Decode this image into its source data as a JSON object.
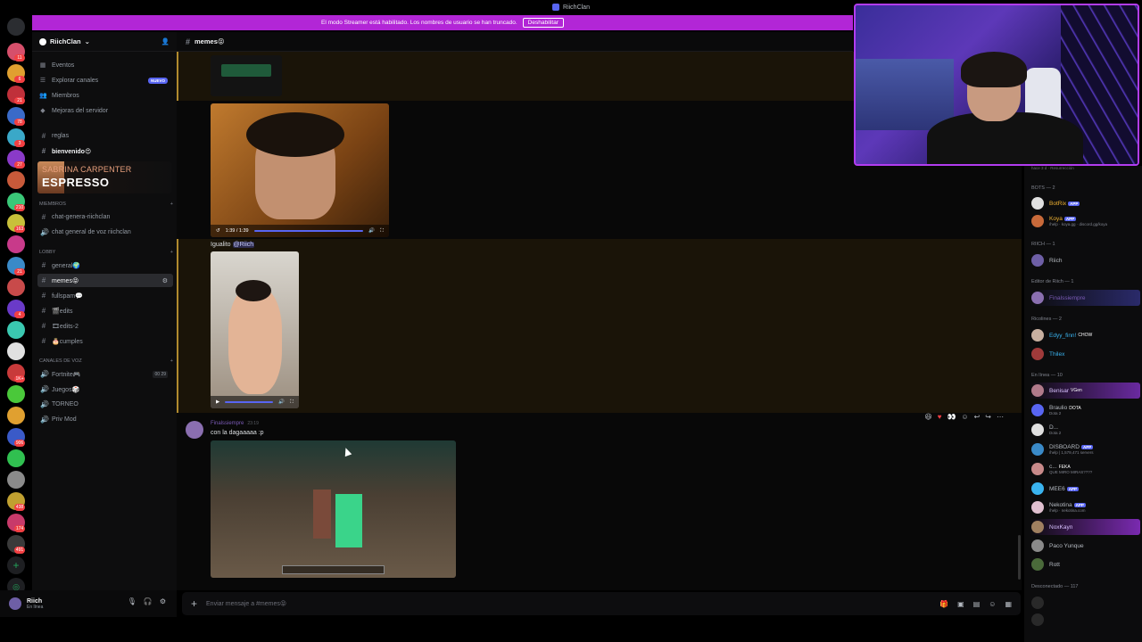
{
  "window": {
    "title": "RiichClan"
  },
  "banner": {
    "text": "El modo Streamer está habilitado. Los nombres de usuario se han truncado.",
    "button": "Deshabilitar"
  },
  "server_rail": {
    "badges": [
      "11",
      "6",
      "21",
      "78",
      "3",
      "27",
      "26",
      "210",
      "163",
      "79",
      "21",
      "45",
      "4",
      "1K+",
      "81",
      "7",
      "906",
      "26",
      "438",
      "1",
      "174",
      "491"
    ]
  },
  "server": {
    "name": "RiichClan"
  },
  "nav": {
    "events": "Eventos",
    "explore": "Explorar canales",
    "explore_badge": "NUEVO",
    "members": "Miembros",
    "boosts": "Mejoras del servidor"
  },
  "channels_top": [
    {
      "name": "reglas"
    },
    {
      "name": "bienvenido😍"
    }
  ],
  "promo": {
    "line1": "SABRINA CARPENTER",
    "line2": "ESPRESSO"
  },
  "categories": {
    "miembros": "miembros",
    "lobby": "LOBBY",
    "voice": "Canales de voz"
  },
  "channels_members": [
    {
      "name": "chat-genera-riichclan"
    },
    {
      "name": "chat general de voz riichclan"
    }
  ],
  "channels_lobby": [
    {
      "name": "general🌍"
    },
    {
      "name": "memes😝"
    },
    {
      "name": "fullspam💬"
    },
    {
      "name": "🎬edits"
    },
    {
      "name": "🎞edits-2"
    },
    {
      "name": "🎂cumples"
    }
  ],
  "channels_voice": [
    {
      "name": "Fortnite🎮",
      "count_a": "00",
      "count_b": "29"
    },
    {
      "name": "Juegos🎲"
    },
    {
      "name": "TORNEO"
    },
    {
      "name": "Priv Mod"
    }
  ],
  "user": {
    "name": "Riich",
    "status": "En línea"
  },
  "channel": {
    "name": "memes😝"
  },
  "messages": {
    "video1_time": "1:39 / 1:39",
    "reply_text": "Igualito",
    "reply_mention": "@Riich",
    "author": "Finalssiempre",
    "author_time": "23:19",
    "text": "con la dagaaaaa :p"
  },
  "composer": {
    "placeholder": "Enviar mensaje a #memes😝"
  },
  "member_list": {
    "top_hint": "hace 3 d · Resurrección",
    "groups": [
      {
        "title": "BOTS — 2"
      },
      {
        "title": "RIICH — 1"
      },
      {
        "title": "Editor de Riich — 1"
      },
      {
        "title": "Ricolines — 2"
      },
      {
        "title": "En línea — 10"
      },
      {
        "title": "Desconectado — 117"
      }
    ],
    "bots": [
      {
        "name": "BotRix",
        "tag": "APP",
        "sub": ""
      },
      {
        "name": "Koya",
        "tag": "APP",
        "sub": "/help · koya.gg · discord.gg/koya"
      }
    ],
    "riich": [
      {
        "name": "Riich"
      }
    ],
    "editor": [
      {
        "name": "Finalssiempre"
      }
    ],
    "ricolines": [
      {
        "name": "Edyy_finn!",
        "extra": "CHOW"
      },
      {
        "name": "Thilex"
      }
    ],
    "online": [
      {
        "name": "Benisar",
        "sub": "VGen"
      },
      {
        "name": "Braulio",
        "sub": "Dota 2",
        "badge": "DOTA"
      },
      {
        "name": "D...",
        "sub": "Dota 2"
      },
      {
        "name": "DISBOARD",
        "tag": "APP",
        "sub": "/help | 1,579,471 servers"
      },
      {
        "name": "c...",
        "badge": "FEKA",
        "sub": "QUE MIRO MIRAS????"
      },
      {
        "name": "MEE6",
        "tag": "APP",
        "sub": ""
      },
      {
        "name": "Nekotina",
        "tag": "APP",
        "sub": "/help · nekotina.com"
      },
      {
        "name": "NoxKayn",
        "sub": ""
      },
      {
        "name": "Paco Yunque",
        "sub": ""
      },
      {
        "name": "Rott",
        "sub": ""
      }
    ]
  },
  "colors": {
    "banner": "#b226d6",
    "highlight": "#1a1408",
    "accent": "#5865f2",
    "cam_border": "#b23cf0"
  }
}
